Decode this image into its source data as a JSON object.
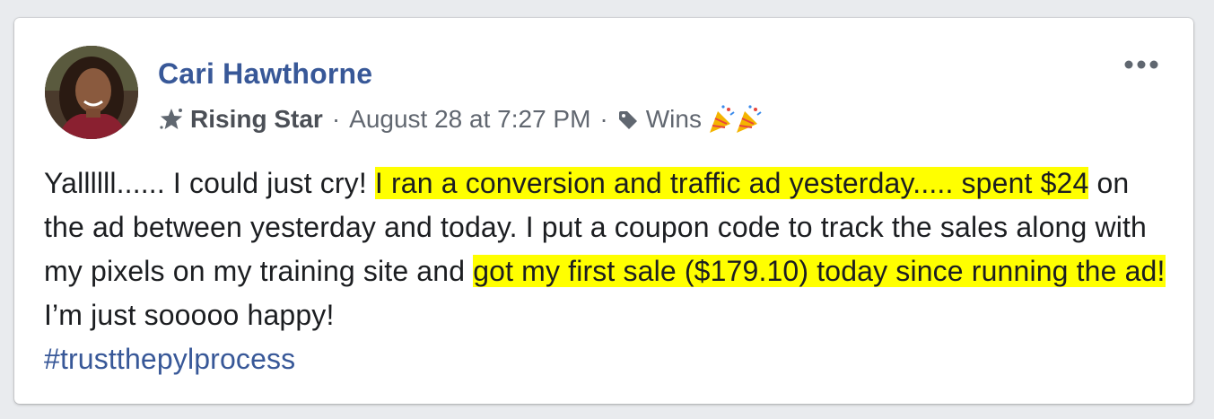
{
  "post": {
    "author": "Cari Hawthorne",
    "badge": "Rising Star",
    "separator": "·",
    "timestamp": "August 28 at 7:27 PM",
    "topic": "Wins",
    "icons": {
      "badge": "star-badge-icon",
      "tag": "tag-icon",
      "celebration": "party-popper-emoji",
      "menu": "more-options-icon"
    },
    "body": {
      "seg1": "Yallllll...... I could just cry! ",
      "seg2": "I ran a conversion and traffic ad yesterday..... spent $24",
      "seg3": " on the ad between yesterday and today. I put a coupon code to track the sales along with my pixels on my training site and ",
      "seg4": "got my first sale ($179.10) today since running the ad!",
      "seg5": " I’m just sooooo happy!",
      "hashtag": "#trustthepylprocess"
    },
    "colors": {
      "author": "#385898",
      "highlight": "#ffff00",
      "text": "#1c1e21",
      "meta": "#616770"
    }
  }
}
